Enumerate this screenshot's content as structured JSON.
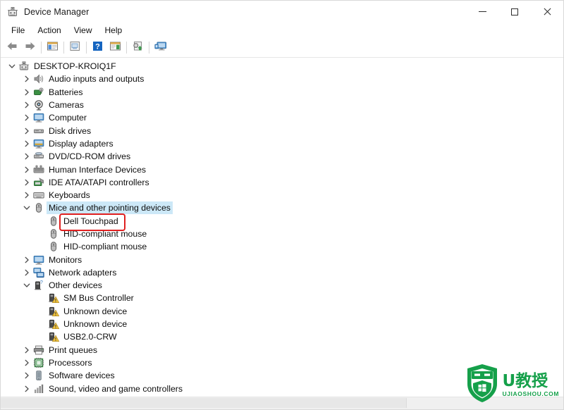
{
  "window": {
    "title": "Device Manager",
    "app_icon": "device-manager-icon",
    "controls": {
      "minimize": "minimize-icon",
      "maximize": "maximize-icon",
      "close": "close-icon"
    }
  },
  "menubar": {
    "items": [
      {
        "label": "File"
      },
      {
        "label": "Action"
      },
      {
        "label": "View"
      },
      {
        "label": "Help"
      }
    ]
  },
  "toolbar": {
    "buttons": [
      {
        "name": "back-button",
        "icon": "left-arrow-icon"
      },
      {
        "name": "forward-button",
        "icon": "right-arrow-icon"
      },
      {
        "name": "separator-1",
        "icon": "separator"
      },
      {
        "name": "show-hide-console-tree-button",
        "icon": "console-tree-icon"
      },
      {
        "name": "separator-2",
        "icon": "separator"
      },
      {
        "name": "properties-button",
        "icon": "properties-icon"
      },
      {
        "name": "separator-3",
        "icon": "separator"
      },
      {
        "name": "help-button",
        "icon": "question-mark-icon"
      },
      {
        "name": "show-hide-action-pane-button",
        "icon": "action-pane-icon"
      },
      {
        "name": "separator-4",
        "icon": "separator"
      },
      {
        "name": "update-driver-button",
        "icon": "update-driver-icon"
      },
      {
        "name": "separator-5",
        "icon": "separator"
      },
      {
        "name": "scan-for-hardware-changes-button",
        "icon": "scan-hardware-icon"
      }
    ]
  },
  "tree": {
    "nodes": [
      {
        "label": "DESKTOP-KROIQ1F",
        "depth": 0,
        "twisty": "expanded",
        "icon": "computer-node-icon"
      },
      {
        "label": "Audio inputs and outputs",
        "depth": 1,
        "twisty": "collapsed",
        "icon": "speaker-icon"
      },
      {
        "label": "Batteries",
        "depth": 1,
        "twisty": "collapsed",
        "icon": "battery-icon"
      },
      {
        "label": "Cameras",
        "depth": 1,
        "twisty": "collapsed",
        "icon": "camera-icon"
      },
      {
        "label": "Computer",
        "depth": 1,
        "twisty": "collapsed",
        "icon": "monitor-icon"
      },
      {
        "label": "Disk drives",
        "depth": 1,
        "twisty": "collapsed",
        "icon": "disk-drive-icon"
      },
      {
        "label": "Display adapters",
        "depth": 1,
        "twisty": "collapsed",
        "icon": "display-adapter-icon"
      },
      {
        "label": "DVD/CD-ROM drives",
        "depth": 1,
        "twisty": "collapsed",
        "icon": "dvd-drive-icon"
      },
      {
        "label": "Human Interface Devices",
        "depth": 1,
        "twisty": "collapsed",
        "icon": "hid-icon"
      },
      {
        "label": "IDE ATA/ATAPI controllers",
        "depth": 1,
        "twisty": "collapsed",
        "icon": "ide-controller-icon"
      },
      {
        "label": "Keyboards",
        "depth": 1,
        "twisty": "collapsed",
        "icon": "keyboard-icon"
      },
      {
        "label": "Mice and other pointing devices",
        "depth": 1,
        "twisty": "expanded",
        "icon": "mouse-icon",
        "selected": true
      },
      {
        "label": "Dell Touchpad",
        "depth": 2,
        "twisty": "none",
        "icon": "mouse-icon",
        "highlighted": true
      },
      {
        "label": "HID-compliant mouse",
        "depth": 2,
        "twisty": "none",
        "icon": "mouse-icon"
      },
      {
        "label": "HID-compliant mouse",
        "depth": 2,
        "twisty": "none",
        "icon": "mouse-icon"
      },
      {
        "label": "Monitors",
        "depth": 1,
        "twisty": "collapsed",
        "icon": "monitor-icon"
      },
      {
        "label": "Network adapters",
        "depth": 1,
        "twisty": "collapsed",
        "icon": "network-adapter-icon"
      },
      {
        "label": "Other devices",
        "depth": 1,
        "twisty": "expanded",
        "icon": "unknown-device-icon"
      },
      {
        "label": "SM Bus Controller",
        "depth": 2,
        "twisty": "none",
        "icon": "unknown-device-warning-icon"
      },
      {
        "label": "Unknown device",
        "depth": 2,
        "twisty": "none",
        "icon": "unknown-device-warning-icon"
      },
      {
        "label": "Unknown device",
        "depth": 2,
        "twisty": "none",
        "icon": "unknown-device-warning-icon"
      },
      {
        "label": "USB2.0-CRW",
        "depth": 2,
        "twisty": "none",
        "icon": "unknown-device-warning-icon"
      },
      {
        "label": "Print queues",
        "depth": 1,
        "twisty": "collapsed",
        "icon": "printer-icon"
      },
      {
        "label": "Processors",
        "depth": 1,
        "twisty": "collapsed",
        "icon": "processor-icon"
      },
      {
        "label": "Software devices",
        "depth": 1,
        "twisty": "collapsed",
        "icon": "software-device-icon"
      },
      {
        "label": "Sound, video and game controllers",
        "depth": 1,
        "twisty": "collapsed",
        "icon": "sound-controller-icon"
      }
    ]
  },
  "watermark": {
    "brand_cn": "U教授",
    "domain": "UJIAOSHOU.COM",
    "color": "#15a04a"
  },
  "colors": {
    "selection": "#cce8f7",
    "highlight_box": "#e02020",
    "text": "#0d0d0d"
  }
}
